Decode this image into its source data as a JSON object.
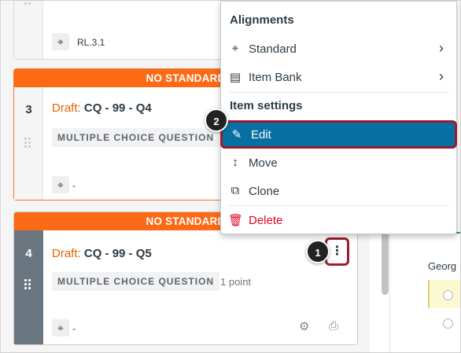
{
  "top_card": {
    "tag_label": "RL.3.1"
  },
  "q3": {
    "banner": "NO STANDARD",
    "number": "3",
    "draft_label": "Draft:",
    "title": "CQ - 99 - Q4",
    "type_label": "MULTIPLE CHOICE QUESTION",
    "tag_label": "-"
  },
  "q4": {
    "banner": "NO STANDARD",
    "number": "4",
    "draft_label": "Draft:",
    "title": "CQ - 99 - Q5",
    "type_label": "MULTIPLE CHOICE QUESTION",
    "points": "1 point",
    "tag_label": "-",
    "menu_button": "⋮"
  },
  "side_panel": {
    "partial_text": "Georg"
  },
  "steps": {
    "one": "1",
    "two": "2"
  },
  "menu": {
    "alignments_header": "Alignments",
    "standard_label": "Standard",
    "item_bank_label": "Item Bank",
    "item_settings_header": "Item settings",
    "edit_label": "Edit",
    "move_label": "Move",
    "clone_label": "Clone",
    "delete_label": "Delete"
  },
  "icons": {
    "tag": "tag-icon",
    "chevron": "chevron-right-icon",
    "pencil": "pencil-icon",
    "move": "move-icon",
    "clone": "clone-icon",
    "trash": "trash-icon",
    "item_bank": "item-bank-icon",
    "print": "print-icon",
    "rubric": "rubric-icon"
  },
  "colors": {
    "banner": "#fc6a16",
    "draft": "#e66000",
    "edit_highlight": "#0770a3",
    "callout_border": "#9b1b2e",
    "delete": "#e0061f"
  }
}
